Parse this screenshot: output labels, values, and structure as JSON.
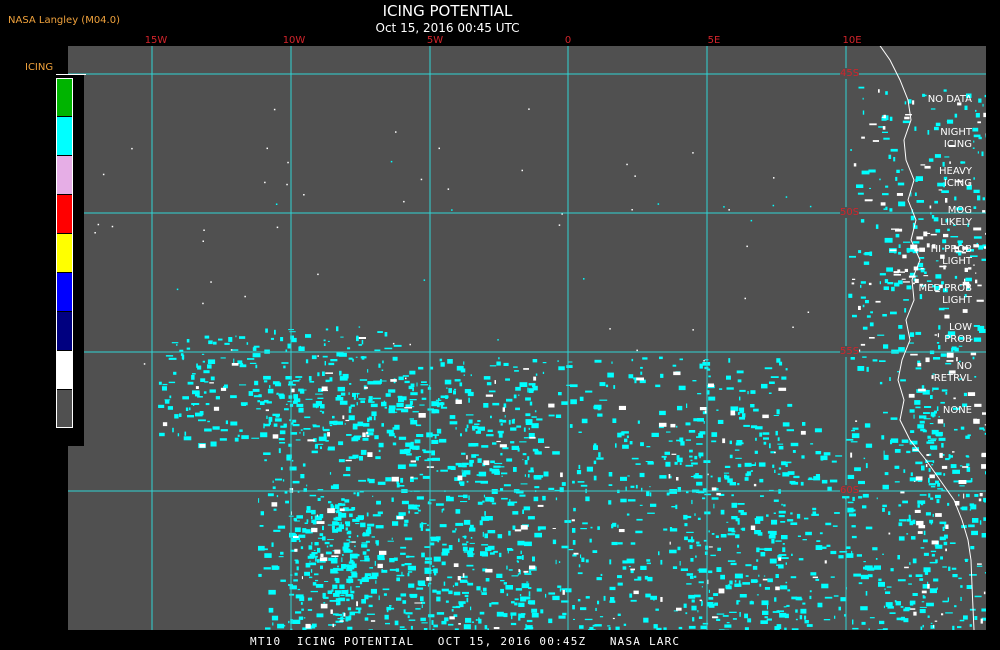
{
  "header": {
    "brand": "NASA Langley (M04.0)",
    "title": "ICING POTENTIAL",
    "subtitle": "Oct 15, 2016 00:45 UTC"
  },
  "map": {
    "longitude_labels": [
      "15W",
      "10W",
      "5W",
      "0",
      "5E",
      "10E"
    ],
    "latitude_labels": [
      "45S",
      "50S",
      "55S",
      "60S"
    ],
    "colors": {
      "background": "#505050",
      "grid": "#2fd5d5",
      "coastline": "#ffffff",
      "night_icing": "#00ffff",
      "no_retrieval": "#ffffff",
      "labels": "#d2242b"
    }
  },
  "legend": {
    "title": "ICING",
    "items": [
      {
        "label": "NO DATA",
        "color": "#00b400"
      },
      {
        "label": "NIGHT\nICING",
        "color": "#00ffff"
      },
      {
        "label": "HEAVY\nICING",
        "color": "#e6aee6"
      },
      {
        "label": "MOG\nLIKELY",
        "color": "#ff0000"
      },
      {
        "label": "HI PROB\nLIGHT",
        "color": "#ffff00"
      },
      {
        "label": "MED PROB\nLIGHT",
        "color": "#0000ff"
      },
      {
        "label": "LOW\nPROB",
        "color": "#000080"
      },
      {
        "label": "NO\nRETRVL",
        "color": "#ffffff"
      },
      {
        "label": "NONE",
        "color": "#505050"
      }
    ]
  },
  "footer": {
    "caption": "MT10  ICING POTENTIAL   OCT 15, 2016 00:45Z   NASA LARC"
  }
}
